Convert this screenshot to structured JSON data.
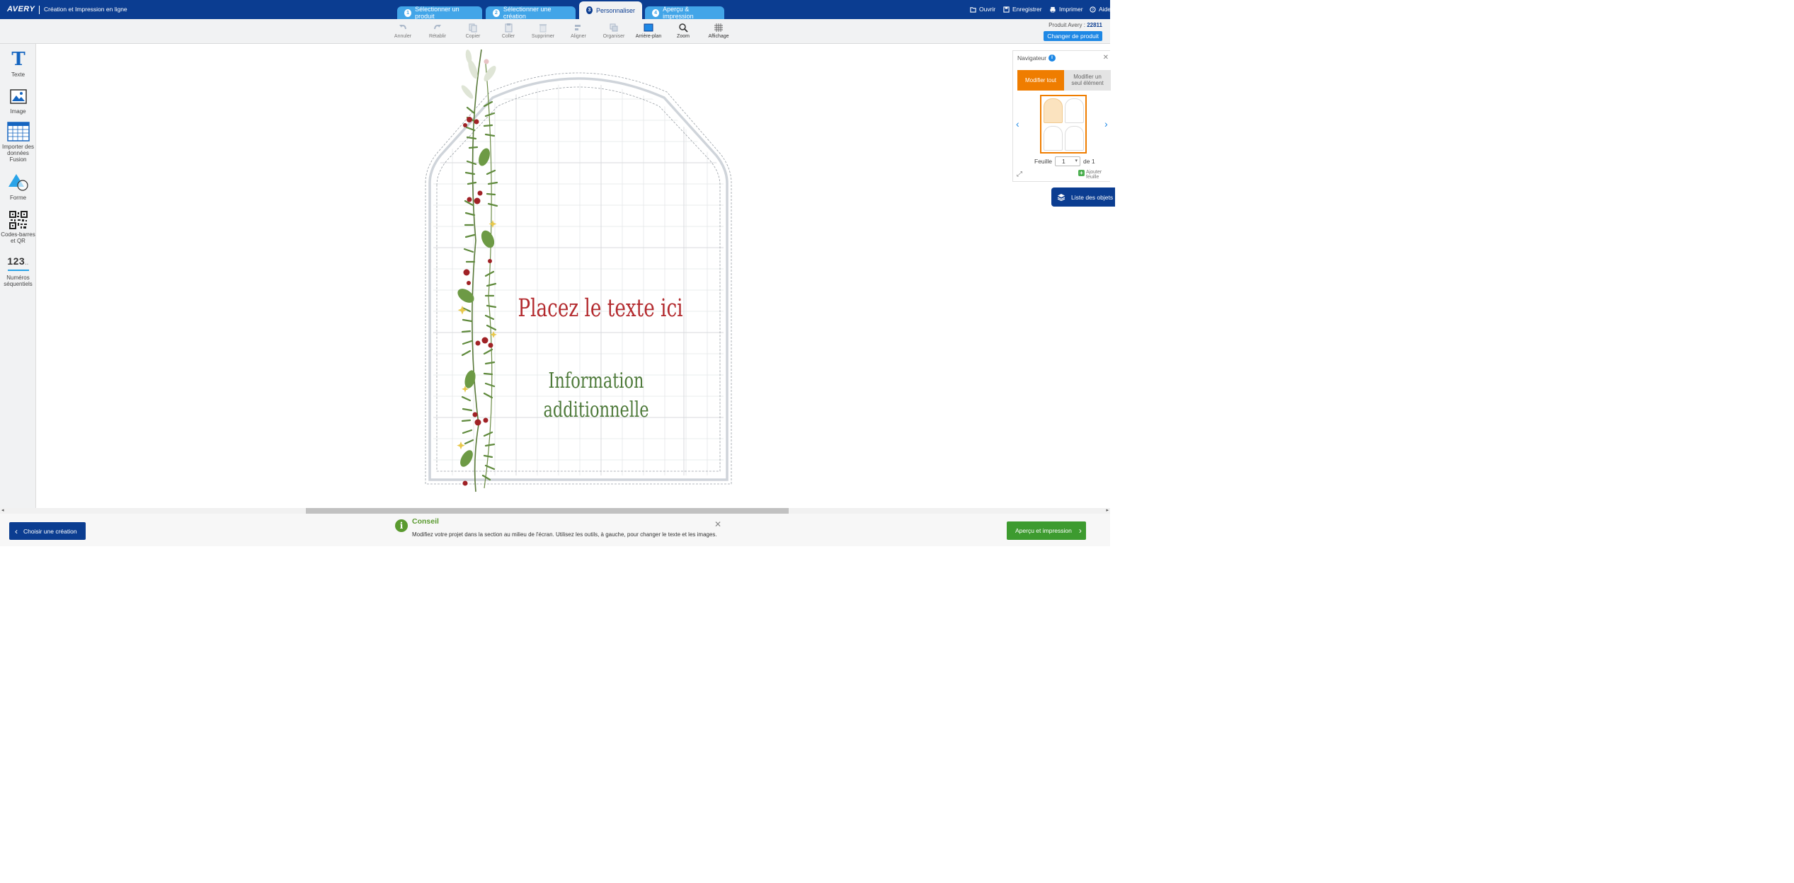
{
  "header": {
    "logo_text": "AVERY",
    "app_title": "Création et Impression en ligne",
    "steps": [
      {
        "num": "1",
        "label": "Sélectionner un produit"
      },
      {
        "num": "2",
        "label": "Sélectionner une création"
      },
      {
        "num": "3",
        "label": "Personnaliser"
      },
      {
        "num": "4",
        "label": "Aperçu & impression"
      }
    ],
    "links": {
      "open": "Ouvrir",
      "save": "Enregistrer",
      "print": "Imprimer",
      "help": "Aide"
    }
  },
  "toolbar": {
    "undo": "Annuler",
    "redo": "Rétablir",
    "copy": "Copier",
    "paste": "Coller",
    "delete": "Supprimer",
    "align": "Aligner",
    "arrange": "Organiser",
    "background": "Arrière-plan",
    "zoom": "Zoom",
    "display": "Affichage",
    "product_label": "Produit Avery : ",
    "product_number": "22811",
    "change_product": "Changer de produit"
  },
  "left_panel": {
    "text": "Texte",
    "image": "Image",
    "import_line1": "Importer des",
    "import_line2": "données",
    "import_line3": "Fusion",
    "shape": "Forme",
    "barcode_line1": "Codes-barres",
    "barcode_line2": "et QR",
    "seq_glyph": "123",
    "seq_line1": "Numéros",
    "seq_line2": "séquentiels"
  },
  "canvas": {
    "main_text": "Placez le texte ici",
    "info_line1": "Information",
    "info_line2": "additionnelle",
    "main_text_color": "#b32a2e",
    "info_text_color": "#4e7a3a"
  },
  "navigator": {
    "title": "Navigateur",
    "modify_all": "Modifier tout",
    "modify_one_line1": "Modifier un",
    "modify_one_line2": "seul élément",
    "sheet_label": "Feuille",
    "sheet_value": "1",
    "sheet_of": "de 1",
    "add_sheet_line1": "Ajouter",
    "add_sheet_line2": "feuille",
    "object_list": "Liste des objets"
  },
  "footer": {
    "choose_design": "Choisir une création",
    "tip_title": "Conseil",
    "tip_text": "Modifiez votre projet dans la section au milieu de l'écran. Utilisez les outils, à gauche, pour changer le texte et les images.",
    "preview_print": "Aperçu et impression"
  },
  "colors": {
    "brand_blue": "#0b3d91",
    "step_blue": "#42a5e8",
    "orange": "#ef7d00",
    "green_button": "#3d9b2f"
  }
}
